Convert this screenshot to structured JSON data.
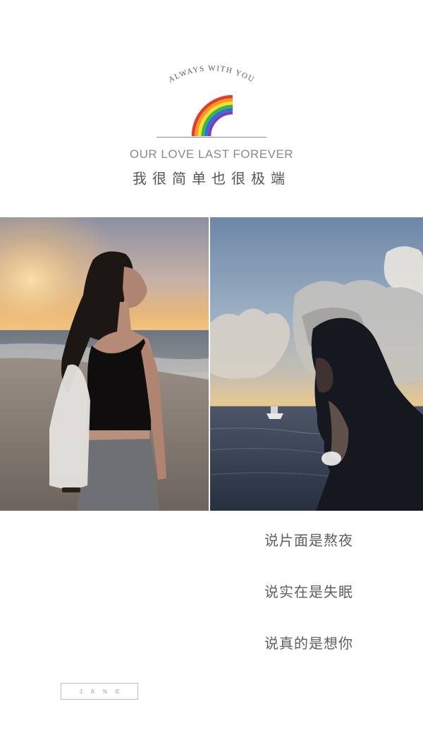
{
  "header": {
    "arc_text": "ALWAYS WITH YOU",
    "tagline_en": "OUR LOVE LAST FOREVER",
    "tagline_cn": "我很简单也很极端",
    "rainbow_colors": [
      "#e63b2e",
      "#f39a22",
      "#f4e02a",
      "#3ab54a",
      "#2f6fd8",
      "#7b3fb8"
    ]
  },
  "photos": {
    "left": {
      "subject": "woman-in-black-top-on-beach-at-sunset"
    },
    "right": {
      "subject": "woman-silhouette-by-sea-with-boat"
    }
  },
  "lyrics": [
    "说片面是熬夜",
    "说实在是失眠",
    "说真的是想你"
  ],
  "signature": "JANE"
}
